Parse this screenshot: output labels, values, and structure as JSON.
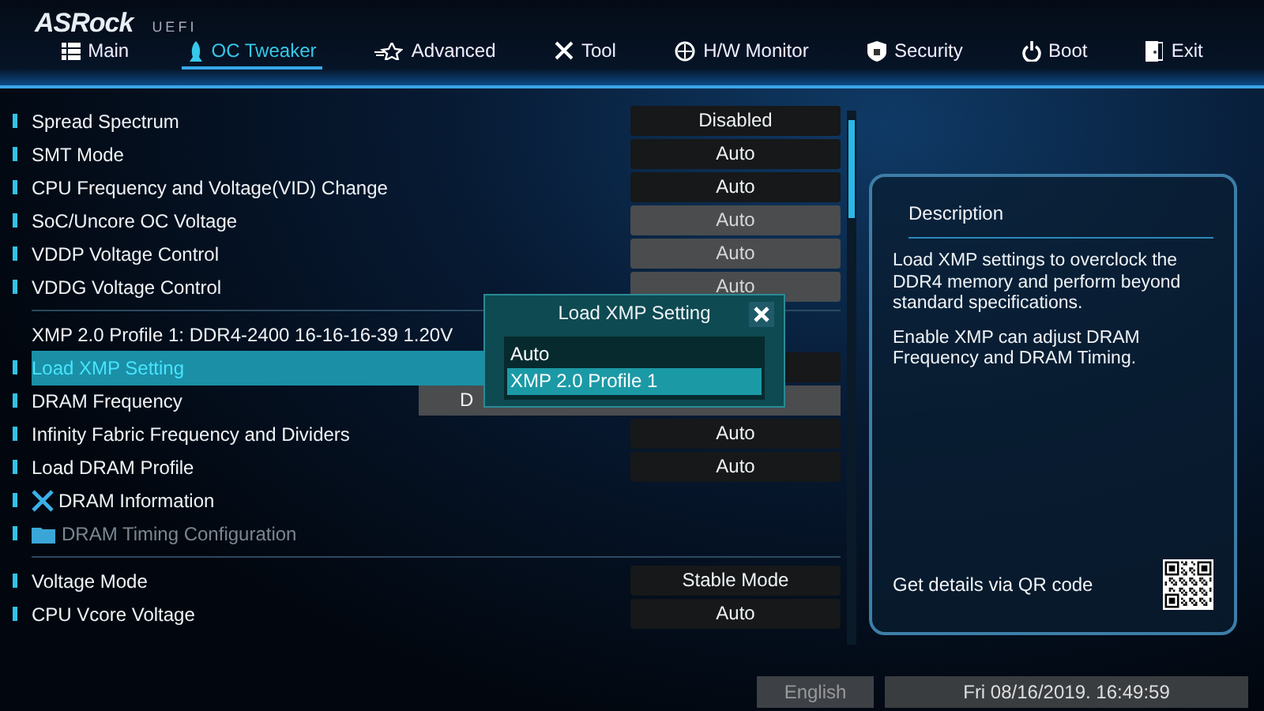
{
  "logo": {
    "brand": "ASRock",
    "product": "UEFI"
  },
  "tabs": [
    {
      "label": "Main",
      "selected": false
    },
    {
      "label": "OC Tweaker",
      "selected": true
    },
    {
      "label": "Advanced",
      "selected": false
    },
    {
      "label": "Tool",
      "selected": false
    },
    {
      "label": "H/W Monitor",
      "selected": false
    },
    {
      "label": "Security",
      "selected": false
    },
    {
      "label": "Boot",
      "selected": false
    },
    {
      "label": "Exit",
      "selected": false
    }
  ],
  "settings": [
    {
      "kind": "setting",
      "label": "Spread Spectrum",
      "value": "Disabled",
      "disabled": false,
      "selected": false
    },
    {
      "kind": "setting",
      "label": "SMT Mode",
      "value": "Auto",
      "disabled": false,
      "selected": false
    },
    {
      "kind": "setting",
      "label": "CPU Frequency and Voltage(VID) Change",
      "value": "Auto",
      "disabled": false,
      "selected": false
    },
    {
      "kind": "setting",
      "label": "SoC/Uncore OC Voltage",
      "value": "Auto",
      "disabled": true,
      "selected": false
    },
    {
      "kind": "setting",
      "label": "VDDP Voltage Control",
      "value": "Auto",
      "disabled": true,
      "selected": false
    },
    {
      "kind": "setting",
      "label": "VDDG Voltage Control",
      "value": "Auto",
      "disabled": true,
      "selected": false
    },
    {
      "kind": "divider"
    },
    {
      "kind": "info",
      "label": "XMP 2.0 Profile 1: DDR4-2400 16-16-16-39 1.20V"
    },
    {
      "kind": "setting",
      "label": "Load XMP Setting",
      "disabled": false,
      "selected": true
    },
    {
      "kind": "wide",
      "label": "DRAM Frequency",
      "value": "D",
      "disabled": true,
      "selected": false
    },
    {
      "kind": "setting",
      "label": "Infinity Fabric Frequency and Dividers",
      "value": "Auto",
      "disabled": false,
      "selected": false
    },
    {
      "kind": "setting",
      "label": "Load DRAM Profile",
      "value": "Auto",
      "disabled": false,
      "selected": false
    },
    {
      "kind": "submenu",
      "label": "DRAM Information",
      "disabled": false
    },
    {
      "kind": "submenu",
      "label": "DRAM Timing Configuration",
      "disabled": true
    },
    {
      "kind": "divider"
    },
    {
      "kind": "setting",
      "label": "Voltage Mode",
      "value": "Stable Mode",
      "disabled": false,
      "selected": false
    },
    {
      "kind": "setting",
      "label": "CPU Vcore Voltage",
      "value": "Auto",
      "disabled": false,
      "selected": false
    }
  ],
  "popup": {
    "title": "Load XMP Setting",
    "options": [
      {
        "label": "Auto",
        "selected": false
      },
      {
        "label": "XMP 2.0 Profile 1",
        "selected": true
      }
    ]
  },
  "description": {
    "title": "Description",
    "paragraphs": [
      "Load XMP settings to overclock the DDR4 memory and perform beyond standard specifications.",
      "Enable XMP can adjust DRAM Frequency and DRAM Timing."
    ],
    "qr_text": "Get details via QR code"
  },
  "status_bar": {
    "language": "English",
    "datetime": "Fri 08/16/2019. 16:49:59"
  }
}
